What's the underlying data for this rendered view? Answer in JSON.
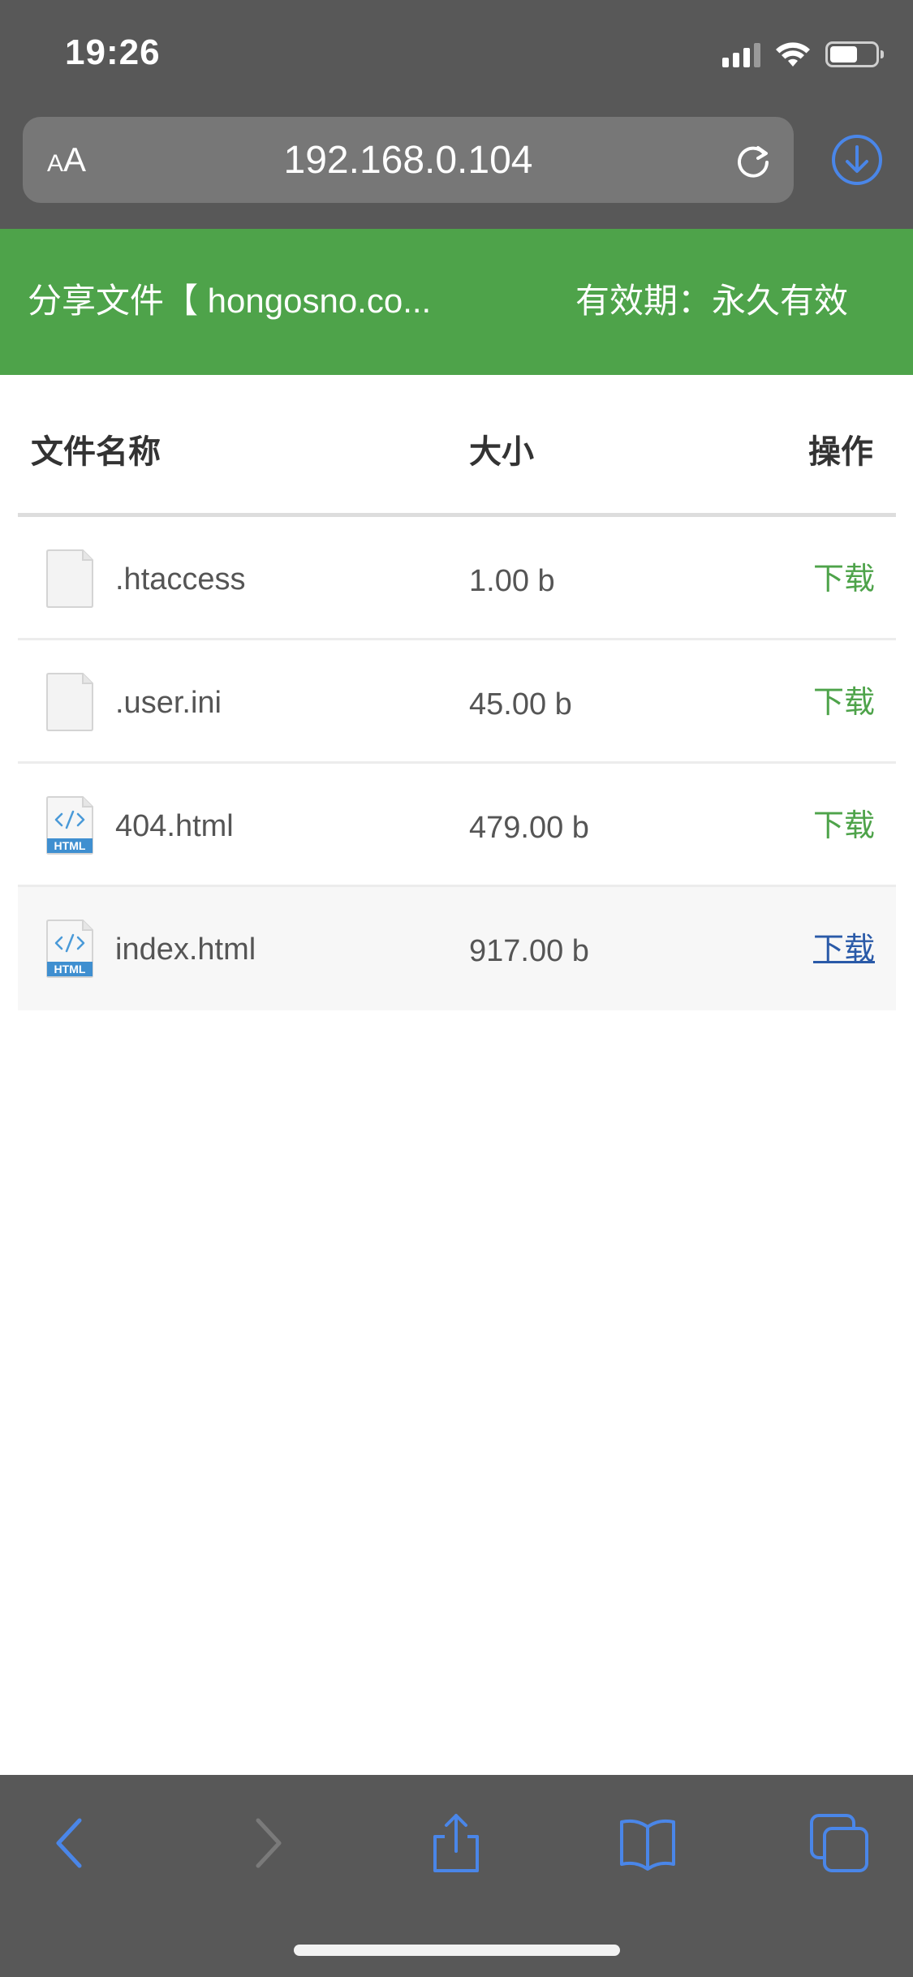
{
  "status_bar": {
    "time": "19:26"
  },
  "browser": {
    "text_size_small": "A",
    "text_size_large": "A",
    "url": "192.168.0.104",
    "icons": [
      "reload-icon",
      "download-icon",
      "back-icon",
      "forward-icon",
      "share-icon",
      "bookmarks-icon",
      "tabs-icon"
    ],
    "accent_color": "#4a86e8"
  },
  "header": {
    "title": "分享文件【 hongosno.co...",
    "expiry": "有效期：永久有效",
    "background_color": "#4ea34a"
  },
  "table": {
    "columns": [
      "文件名称",
      "大小",
      "操作"
    ],
    "rows": [
      {
        "name": ".htaccess",
        "size": "1.00 b",
        "action": "下载",
        "icon": "generic-file-icon"
      },
      {
        "name": ".user.ini",
        "size": "45.00 b",
        "action": "下载",
        "icon": "generic-file-icon"
      },
      {
        "name": "404.html",
        "size": "479.00 b",
        "action": "下载",
        "icon": "html-file-icon"
      },
      {
        "name": "index.html",
        "size": "917.00 b",
        "action": "下载",
        "icon": "html-file-icon"
      }
    ],
    "html_badge": "HTML",
    "action_color": "#4ea34a",
    "hover_action_color": "#2a5aa8"
  }
}
